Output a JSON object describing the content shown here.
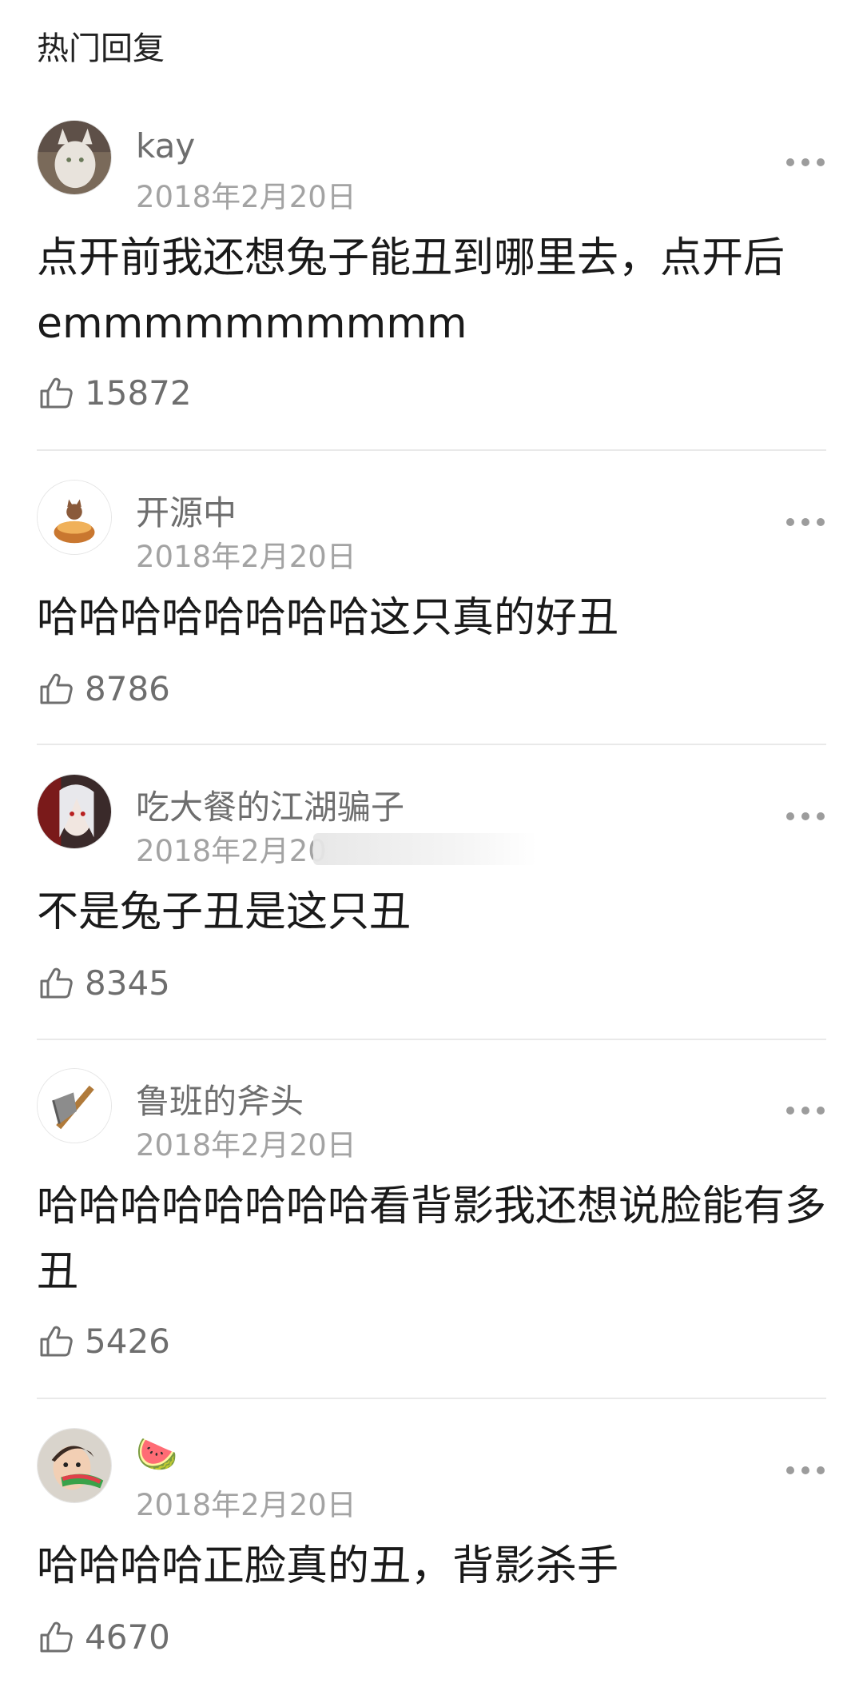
{
  "section": {
    "title": "热门回复"
  },
  "comments": [
    {
      "username": "kay",
      "date": "2018年2月20日",
      "text": "点开前我还想兔子能丑到哪里去，点开后emmmmmmmmmm",
      "likes": "15872"
    },
    {
      "username": "开源中",
      "date": "2018年2月20日",
      "text": "哈哈哈哈哈哈哈哈这只真的好丑",
      "likes": "8786"
    },
    {
      "username": "吃大餐的江湖骗子",
      "date": "2018年2月20",
      "text": "不是兔子丑是这只丑",
      "likes": "8345"
    },
    {
      "username": "鲁班的斧头",
      "date": "2018年2月20日",
      "text": "哈哈哈哈哈哈哈哈看背影我还想说脸能有多丑",
      "likes": "5426"
    },
    {
      "username": "🍉",
      "date": "2018年2月20日",
      "text": "哈哈哈哈正脸真的丑，背影杀手",
      "likes": "4670"
    }
  ],
  "icons": {
    "like": "thumbs-up-icon",
    "more": "more-dots-icon"
  },
  "colors": {
    "username": "#6e6e6e",
    "date": "#a3a3a3",
    "text": "#1a1a1a",
    "divider": "#e9e9e9"
  }
}
